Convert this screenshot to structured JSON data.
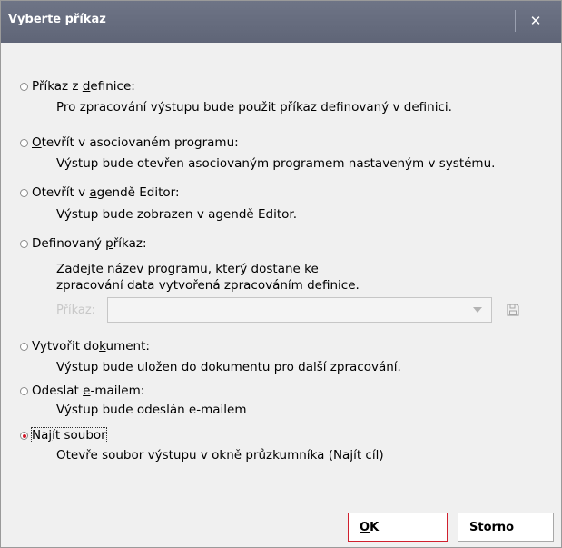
{
  "window": {
    "title": "Vyberte příkaz",
    "close_symbol": "✕"
  },
  "options": [
    {
      "pre": "Příkaz z ",
      "ul": "d",
      "post": "efinice:",
      "desc": [
        "Pro zpracování výstupu bude použit příkaz definovaný v definici."
      ],
      "checked": false
    },
    {
      "pre": "",
      "ul": "O",
      "post": "tevřít v asociovaném programu:",
      "desc": [
        "Výstup bude otevřen asociovaným programem nastaveným v systému."
      ],
      "checked": false
    },
    {
      "pre": "Otevřít v ",
      "ul": "a",
      "post": "gendě Editor:",
      "desc": [
        "Výstup bude zobrazen v agendě Editor."
      ],
      "checked": false
    },
    {
      "pre": "Definovaný ",
      "ul": "p",
      "post": "říkaz:",
      "desc": [
        "Zadejte název programu, který dostane ke",
        "zpracování data vytvořená zpracováním definice."
      ],
      "checked": false
    },
    {
      "pre": "Vytvořit do",
      "ul": "k",
      "post": "ument:",
      "desc": [
        "Výstup bude uložen do dokumentu pro další zpracování."
      ],
      "checked": false
    },
    {
      "pre": "Odeslat ",
      "ul": "e",
      "post": "-mailem:",
      "desc": [
        "Výstup bude odeslán e-mailem"
      ],
      "checked": false
    },
    {
      "pre": "Na",
      "ul": "j",
      "post": "ít soubor",
      "desc": [
        "Otevře soubor výstupu v okně průzkumníka (Najít cíl)"
      ],
      "checked": true
    }
  ],
  "command": {
    "label": "Příkaz:",
    "value": "",
    "browse_icon": "save-icon"
  },
  "buttons": {
    "ok_ul": "O",
    "ok_rest": "K",
    "cancel": "Storno"
  },
  "colors": {
    "titlebar": "#646a7c",
    "accent": "#d0202e",
    "background": "#f0f0f0"
  }
}
